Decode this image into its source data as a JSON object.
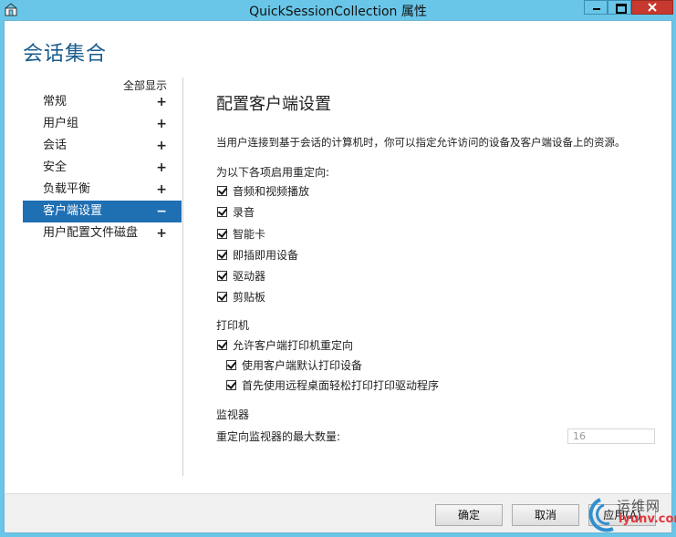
{
  "window": {
    "title": "QuickSessionCollection 属性"
  },
  "heading": "会话集合",
  "nav": {
    "show_all": "全部显示",
    "items": [
      {
        "label": "常规",
        "sym": "+"
      },
      {
        "label": "用户组",
        "sym": "+"
      },
      {
        "label": "会话",
        "sym": "+"
      },
      {
        "label": "安全",
        "sym": "+"
      },
      {
        "label": "负载平衡",
        "sym": "+"
      },
      {
        "label": "客户端设置",
        "sym": "−"
      },
      {
        "label": "用户配置文件磁盘",
        "sym": "+"
      }
    ],
    "active_index": 5
  },
  "panel": {
    "title": "配置客户端设置",
    "description": "当用户连接到基于会话的计算机时，你可以指定允许访问的设备及客户端设备上的资源。",
    "redirect_label": "为以下各项启用重定向:",
    "redirect_items": [
      {
        "label": "音频和视频播放",
        "checked": true
      },
      {
        "label": "录音",
        "checked": true
      },
      {
        "label": "智能卡",
        "checked": true
      },
      {
        "label": "即插即用设备",
        "checked": true
      },
      {
        "label": "驱动器",
        "checked": true
      },
      {
        "label": "剪贴板",
        "checked": true
      }
    ],
    "printer_label": "打印机",
    "printer_items": [
      {
        "label": "允许客户端打印机重定向",
        "checked": true
      },
      {
        "label": "使用客户端默认打印设备",
        "checked": true
      },
      {
        "label": "首先使用远程桌面轻松打印打印驱动程序",
        "checked": true
      }
    ],
    "monitor_label": "监视器",
    "monitor_max_label": "重定向监视器的最大数量:",
    "monitor_max_value": "16"
  },
  "footer": {
    "ok": "确定",
    "cancel": "取消",
    "apply": "应用(A)"
  },
  "watermark": {
    "line1": "运维网",
    "line2": "iyunv.com"
  }
}
